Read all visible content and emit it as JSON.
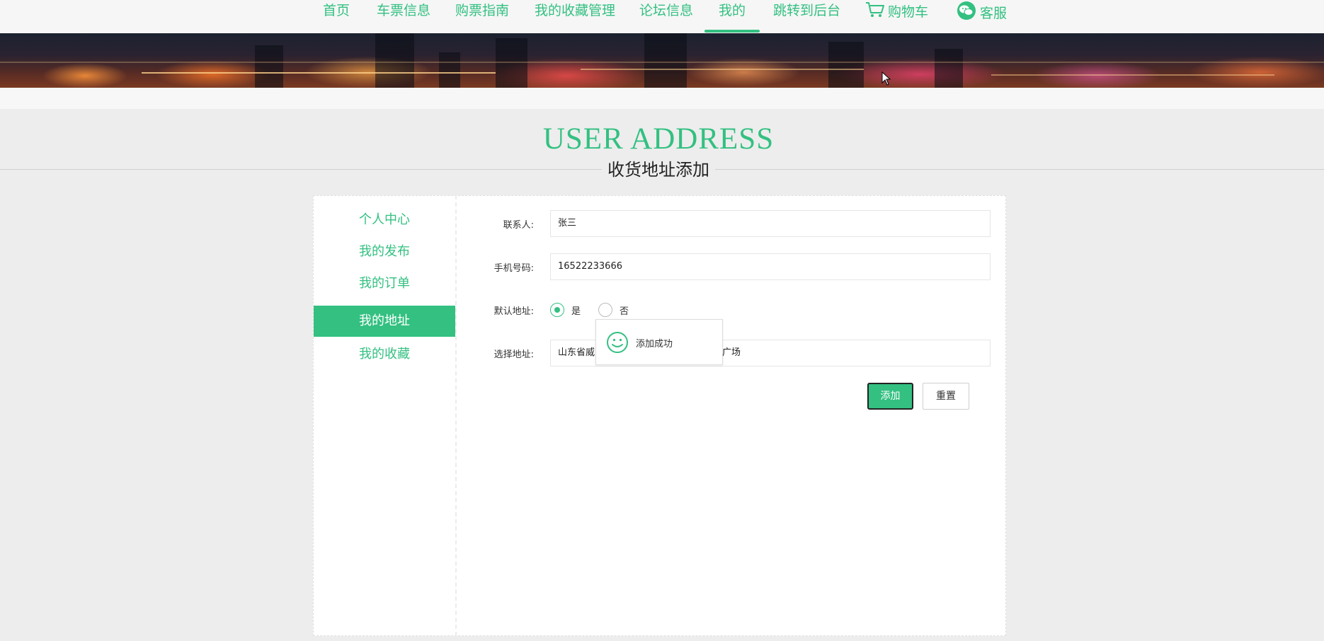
{
  "nav": {
    "items": [
      {
        "label": "首页"
      },
      {
        "label": "车票信息"
      },
      {
        "label": "购票指南"
      },
      {
        "label": "我的收藏管理"
      },
      {
        "label": "论坛信息"
      },
      {
        "label": "我的"
      },
      {
        "label": "跳转到后台"
      }
    ],
    "cart_label": "购物车",
    "service_label": "客服",
    "active": "我的"
  },
  "heading": {
    "en": "USER ADDRESS",
    "cn": "收货地址添加"
  },
  "sidebar": {
    "items": [
      {
        "label": "个人中心"
      },
      {
        "label": "我的发布"
      },
      {
        "label": "我的订单"
      },
      {
        "label": "我的地址"
      },
      {
        "label": "我的收藏"
      }
    ],
    "active": "我的地址"
  },
  "form": {
    "contact_label": "联系人:",
    "contact_value": "张三",
    "phone_label": "手机号码:",
    "phone_value": "16522233666",
    "default_label": "默认地址:",
    "default_yes": "是",
    "default_no": "否",
    "default_selected": "是",
    "address_label": "选择地址:",
    "address_value_left": "山东省威",
    "address_value_right": "广场",
    "add_button": "添加",
    "reset_button": "重置"
  },
  "toast": {
    "message": "添加成功"
  },
  "colors": {
    "accent": "#33c081",
    "background": "#ededed"
  }
}
